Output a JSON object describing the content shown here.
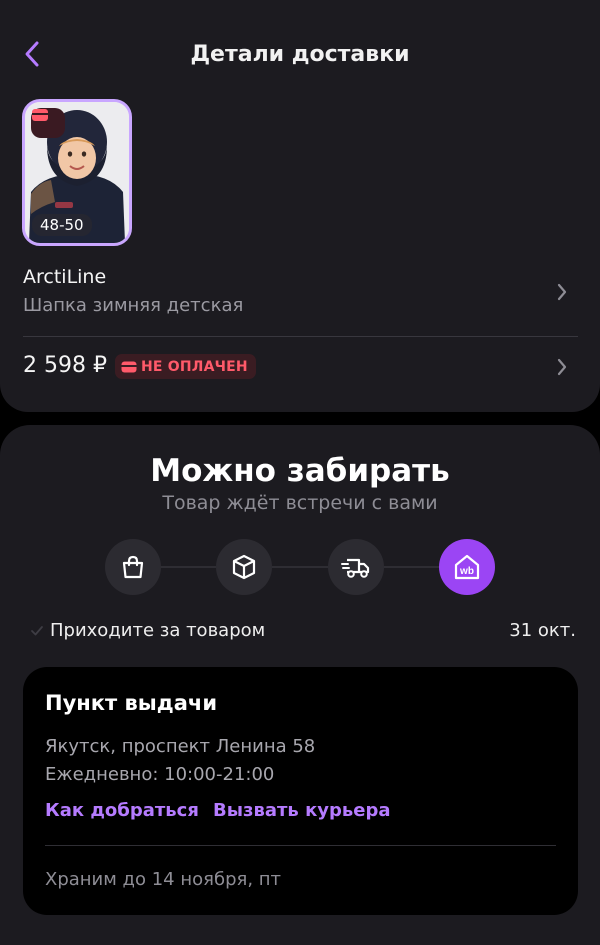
{
  "header": {
    "title": "Детали доставки",
    "back_icon": "chevron-left-icon"
  },
  "product": {
    "size": "48-50",
    "brand": "ArctiLine",
    "name": "Шапка зимняя детская",
    "price": "2 598 ₽",
    "payment_status": "НЕ ОПЛАЧЕН",
    "payment_status_color": "#ff5a6a"
  },
  "status": {
    "title": "Можно забирать",
    "subtitle": "Товар ждёт встречи с вами",
    "steps": [
      {
        "icon": "shopping-bag-icon",
        "active": false
      },
      {
        "icon": "box-icon",
        "active": false
      },
      {
        "icon": "delivery-truck-icon",
        "active": false
      },
      {
        "icon": "wb-pickup-point-icon",
        "active": true
      }
    ],
    "step_label": "Приходите за товаром",
    "step_date": "31 окт.",
    "accent_color": "#9b45f4"
  },
  "pickup": {
    "title": "Пункт выдачи",
    "address": "Якутск, проспект Ленина 58",
    "hours": "Ежедневно: 10:00-21:00",
    "directions_link": "Как добраться",
    "courier_link": "Вызвать курьера",
    "storage_note": "Храним до 14 ноября, пт"
  }
}
